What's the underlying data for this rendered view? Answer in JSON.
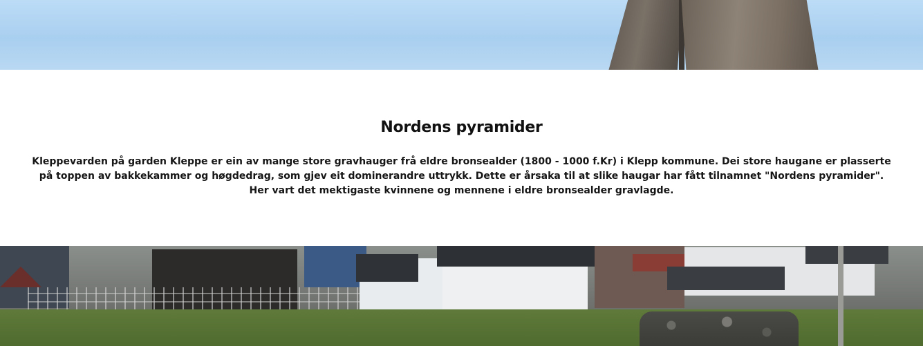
{
  "section": {
    "title": "Nordens pyramider",
    "body": "Kleppevarden på garden Kleppe er ein av mange store gravhauger frå eldre bronsealder (1800 - 1000 f.Kr) i Klepp kommune. Dei store haugane er plasserte på toppen av bakkekammer og høgdedrag, som gjev eit dominerandre uttrykk. Dette er årsaka til at slike haugar har fått tilnamnet \"Nordens pyramider\". Her vart det mektigaste kvinnene og mennene i eldre bronsealder gravlagde."
  },
  "images": {
    "top": "standing-stone-photo",
    "bottom": "residential-landscape-photo"
  },
  "colors": {
    "background": "#ffffff",
    "text": "#161616",
    "sky": "#b1d4f2"
  }
}
